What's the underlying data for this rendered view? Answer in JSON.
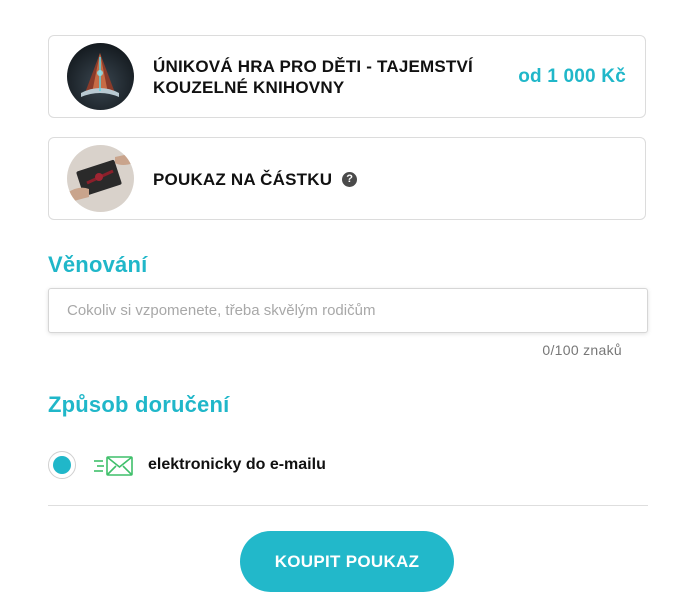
{
  "products": [
    {
      "title": "Úniková hra pro děti - tajemství kouzelné knihovny",
      "price": "od 1 000 Kč",
      "image_icon": "magic-book-image"
    },
    {
      "title": "Poukaz na částku",
      "help_icon": "question-icon",
      "help_glyph": "?",
      "image_icon": "gift-voucher-image"
    }
  ],
  "dedication": {
    "heading": "Věnování",
    "placeholder": "Cokoliv si vzpomenete, třeba skvělým rodičům",
    "value": "",
    "counter": "0/100 znaků"
  },
  "delivery": {
    "heading": "Způsob doručení",
    "options": [
      {
        "label": "elektronicky do e-mailu",
        "selected": true,
        "icon": "email-send-icon"
      }
    ]
  },
  "actions": {
    "buy_label": "Koupit poukaz"
  },
  "colors": {
    "accent": "#20b7c9",
    "text": "#111111",
    "border": "#dcdcdc"
  }
}
